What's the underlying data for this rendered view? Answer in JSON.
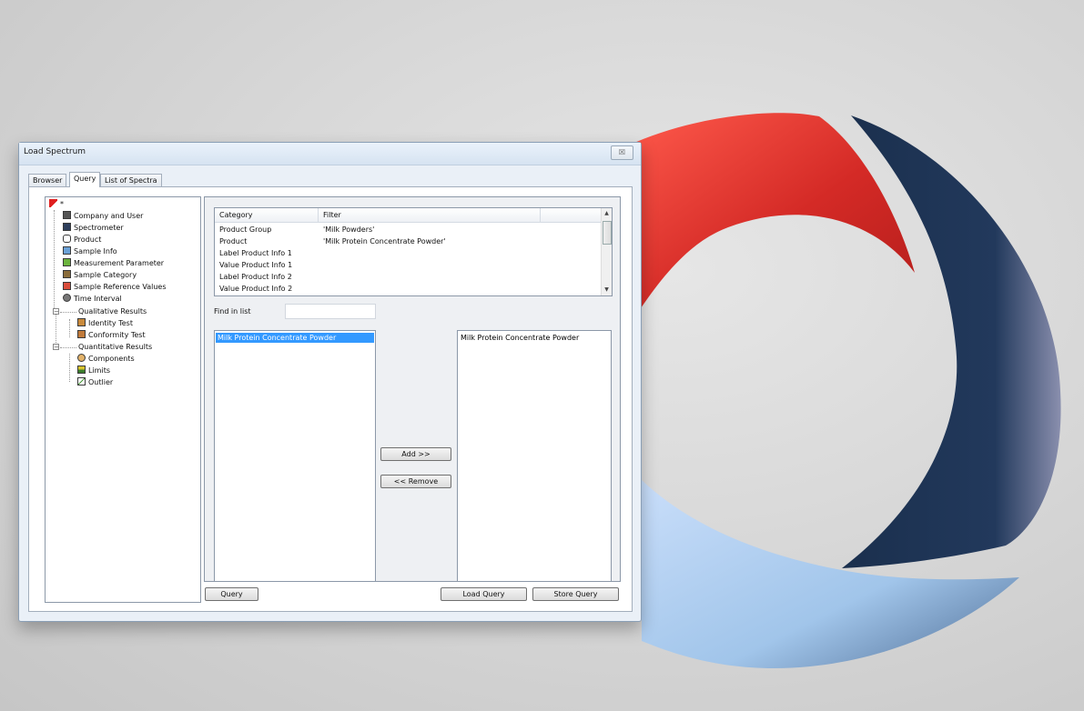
{
  "window": {
    "title": "Load Spectrum",
    "close_glyph": "☒"
  },
  "tabs": [
    {
      "label": "Browser"
    },
    {
      "label": "Query"
    },
    {
      "label": "List of Spectra"
    }
  ],
  "tree": {
    "root": {
      "label": "*",
      "icon": "red-flag-icon"
    },
    "items": [
      {
        "label": "Company and User",
        "icon": "company-icon"
      },
      {
        "label": "Spectrometer",
        "icon": "spectrometer-icon"
      },
      {
        "label": "Product",
        "icon": "product-icon"
      },
      {
        "label": "Sample Info",
        "icon": "sample-info-icon"
      },
      {
        "label": "Measurement Parameter",
        "icon": "measurement-icon"
      },
      {
        "label": "Sample Category",
        "icon": "category-icon"
      },
      {
        "label": "Sample Reference Values",
        "icon": "reference-values-icon"
      },
      {
        "label": "Time Interval",
        "icon": "clock-icon"
      },
      {
        "label": "Qualitative Results",
        "icon": ""
      },
      {
        "label": "Identity Test",
        "icon": "identity-icon"
      },
      {
        "label": "Conformity Test",
        "icon": "conformity-icon"
      },
      {
        "label": "Quantitative Results",
        "icon": ""
      },
      {
        "label": "Components",
        "icon": "components-icon"
      },
      {
        "label": "Limits",
        "icon": "limits-icon"
      },
      {
        "label": "Outlier",
        "icon": "outlier-icon"
      }
    ]
  },
  "filter_table": {
    "headers": {
      "category": "Category",
      "filter": "Filter"
    },
    "rows": [
      {
        "category": "Product Group",
        "filter": "'Milk Powders'"
      },
      {
        "category": "Product",
        "filter": "'Milk Protein Concentrate Powder'"
      },
      {
        "category": "Label Product Info 1",
        "filter": ""
      },
      {
        "category": "Value Product Info 1",
        "filter": ""
      },
      {
        "category": "Label Product Info 2",
        "filter": ""
      },
      {
        "category": "Value Product Info 2",
        "filter": ""
      }
    ],
    "scroll_up": "▲",
    "scroll_down": "▼"
  },
  "find": {
    "label": "Find in list",
    "value": ""
  },
  "available_list": {
    "items": [
      "Milk Protein Concentrate Powder"
    ],
    "selected_index": 0
  },
  "selected_list": {
    "items": [
      "Milk Protein Concentrate Powder"
    ]
  },
  "buttons": {
    "add": "Add >>",
    "remove": "<< Remove",
    "query": "Query",
    "load_query": "Load Query",
    "store_query": "Store Query"
  },
  "colors": {
    "logo_red": "#d42a26",
    "logo_navy": "#1f3656",
    "logo_light_blue": "#9cc3e8",
    "selection": "#3399ff"
  }
}
